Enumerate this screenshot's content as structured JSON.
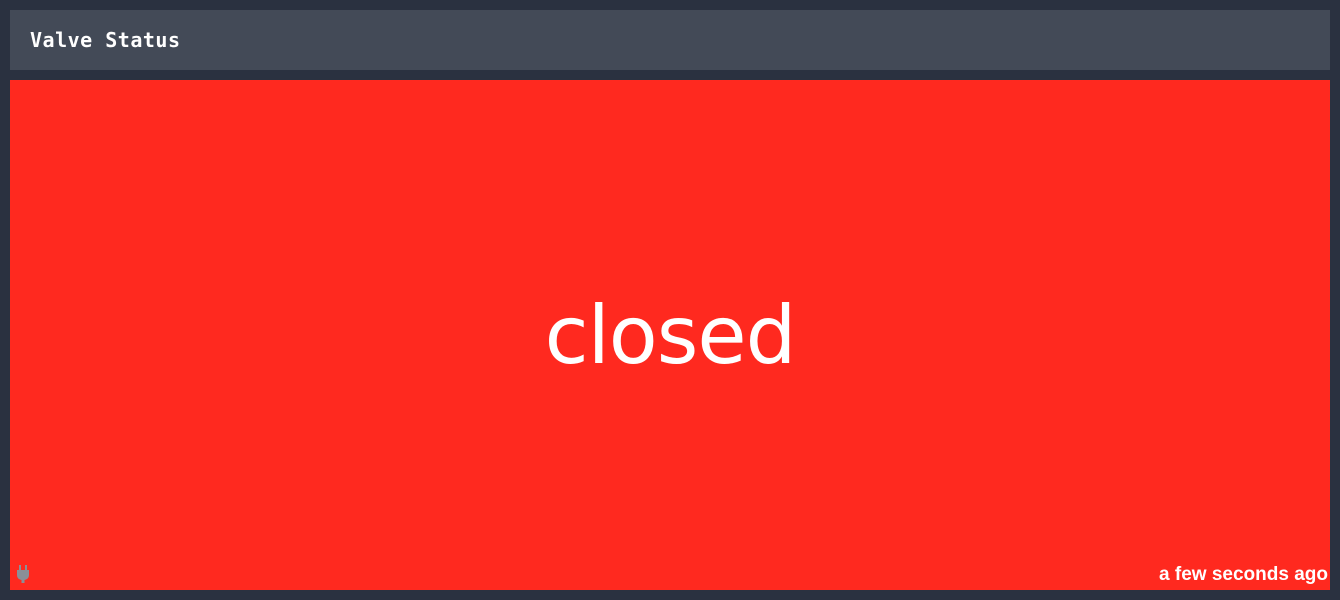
{
  "widget": {
    "title": "Valve Status",
    "status": "closed",
    "updated": "a few seconds ago",
    "connection_icon": "plug-icon"
  },
  "colors": {
    "page_background": "#2a3140",
    "header_background": "#434a57",
    "status_background": "#ff291f",
    "text": "#ffffff",
    "icon": "#8a8f98"
  }
}
